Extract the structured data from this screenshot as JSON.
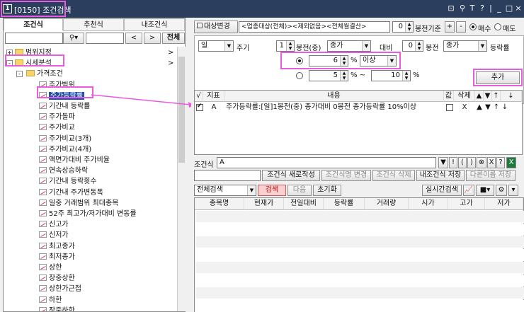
{
  "window": {
    "num": "1",
    "title": "[0150] 조건검색",
    "controls": [
      "⊡",
      "⚲",
      "T",
      "?",
      "|",
      "_",
      "□",
      "×"
    ]
  },
  "left": {
    "tabs": [
      "조건식",
      "추천식",
      "내조건식"
    ],
    "search_value": "",
    "search_icon": "magnifier-icon",
    "prev_label": "<",
    "next_label": ">",
    "all_label": "전체",
    "tree": [
      {
        "label": "범위지정",
        "level": 0,
        "kind": "folder",
        "expand": "+",
        "arrow": ">"
      },
      {
        "label": "시세분석",
        "level": 0,
        "kind": "folder",
        "expand": "-",
        "arrow": ">"
      },
      {
        "label": "가격조건",
        "level": 1,
        "kind": "folder",
        "expand": "-"
      },
      {
        "label": "주가범위",
        "level": 2,
        "kind": "leaf"
      },
      {
        "label": "주가등락률",
        "level": 2,
        "kind": "leaf",
        "selected": true
      },
      {
        "label": "기간내 등락률",
        "level": 2,
        "kind": "leaf"
      },
      {
        "label": "주가돌파",
        "level": 2,
        "kind": "leaf"
      },
      {
        "label": "주가비교",
        "level": 2,
        "kind": "leaf"
      },
      {
        "label": "주가비교(3개)",
        "level": 2,
        "kind": "leaf"
      },
      {
        "label": "주가비교(4개)",
        "level": 2,
        "kind": "leaf"
      },
      {
        "label": "액면가대비 주가비율",
        "level": 2,
        "kind": "leaf"
      },
      {
        "label": "연속상승하락",
        "level": 2,
        "kind": "leaf"
      },
      {
        "label": "기간내 등락횟수",
        "level": 2,
        "kind": "leaf"
      },
      {
        "label": "기간내 주가변동폭",
        "level": 2,
        "kind": "leaf"
      },
      {
        "label": "일중 거래범위 최대종목",
        "level": 2,
        "kind": "leaf"
      },
      {
        "label": "52주 최고가/저가대비 변동률",
        "level": 2,
        "kind": "leaf"
      },
      {
        "label": "신고가",
        "level": 2,
        "kind": "leaf"
      },
      {
        "label": "신저가",
        "level": 2,
        "kind": "leaf"
      },
      {
        "label": "최고종가",
        "level": 2,
        "kind": "leaf"
      },
      {
        "label": "최저종가",
        "level": 2,
        "kind": "leaf"
      },
      {
        "label": "상한",
        "level": 2,
        "kind": "leaf"
      },
      {
        "label": "장중상한",
        "level": 2,
        "kind": "leaf"
      },
      {
        "label": "상한가근접",
        "level": 2,
        "kind": "leaf"
      },
      {
        "label": "하한",
        "level": 2,
        "kind": "leaf"
      },
      {
        "label": "장중하한",
        "level": 2,
        "kind": "leaf"
      },
      {
        "label": "하한가근접",
        "level": 2,
        "kind": "leaf"
      }
    ]
  },
  "right": {
    "target_label": "대상변경",
    "target_value": "<업종대상(전체)><제외없음><전체월결산>",
    "base_value": "0",
    "base_label": "봉전기준",
    "plus": "+",
    "minus": "-",
    "buy_label": "매수",
    "sell_label": "매도",
    "period": "일",
    "period_label": "주기",
    "n1": "1",
    "bong1": "봉전(중)",
    "price1": "종가",
    "vs_label": "대비",
    "n2": "0",
    "bong2": "봉전",
    "price2": "종가",
    "rate_label": "등락률",
    "r1_value": "6",
    "pct1": "%",
    "cond": "이상",
    "r2_from": "5",
    "pct2": "% ~",
    "r2_to": "10",
    "pct3": "%",
    "add_label": "추가",
    "cond_headers": [
      "√",
      "지표",
      "내용",
      "값",
      "삭제",
      "▲",
      "▼",
      "↑",
      "↓"
    ],
    "cond_rows": [
      {
        "alpha": "A",
        "content": "주가등락률:[일]1봉전(중) 종가대비 0봉전 종가등락률 10%이상",
        "del": "X",
        "up": "▲",
        "down": "▼",
        "top": "↑",
        "bottom": "↓"
      }
    ],
    "formula_label": "조건식",
    "formula_value": "A",
    "formula_buttons": [
      "▼",
      "!",
      "(",
      ")",
      "⊗",
      "X",
      "?"
    ],
    "btn_new": "조건식 새로작성",
    "btn_rename": "조건식명 변경",
    "btn_delete": "조건식 삭제",
    "btn_save": "내조건식 저장",
    "btn_saveas": "다른이름 저장",
    "search_scope": "전체검색",
    "search_btn": "검색",
    "next_btn": "다음",
    "reset_btn": "초기화",
    "realtime_btn": "실시간검색",
    "result_headers": [
      "종목명",
      "현재가",
      "전일대비",
      "등락률",
      "거래량",
      "시가",
      "고가",
      "저가"
    ],
    "accent_pink": "#e85ce0"
  }
}
